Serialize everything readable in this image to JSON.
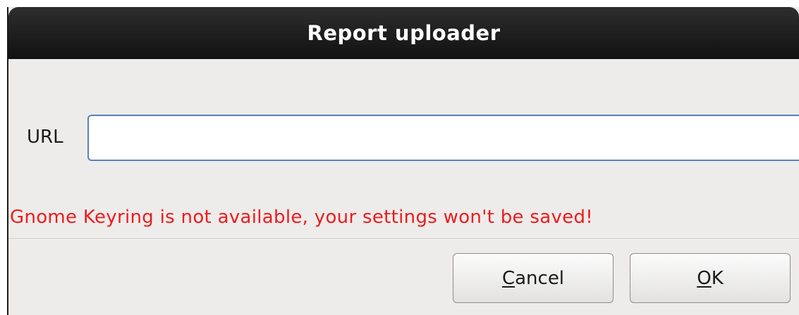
{
  "dialog": {
    "title": "Report uploader",
    "url_label": "URL",
    "url_value": "",
    "url_placeholder": "",
    "warning": "Gnome Keyring is not available, your settings won't be saved!",
    "buttons": {
      "cancel": {
        "mnemonic": "C",
        "rest": "ancel"
      },
      "ok": {
        "mnemonic": "O",
        "rest": "K"
      }
    },
    "colors": {
      "warning": "#ee1c1c",
      "titlebar": "#1a1a1a",
      "input_focus_border": "#5c82b8",
      "background": "#edeceb"
    }
  }
}
